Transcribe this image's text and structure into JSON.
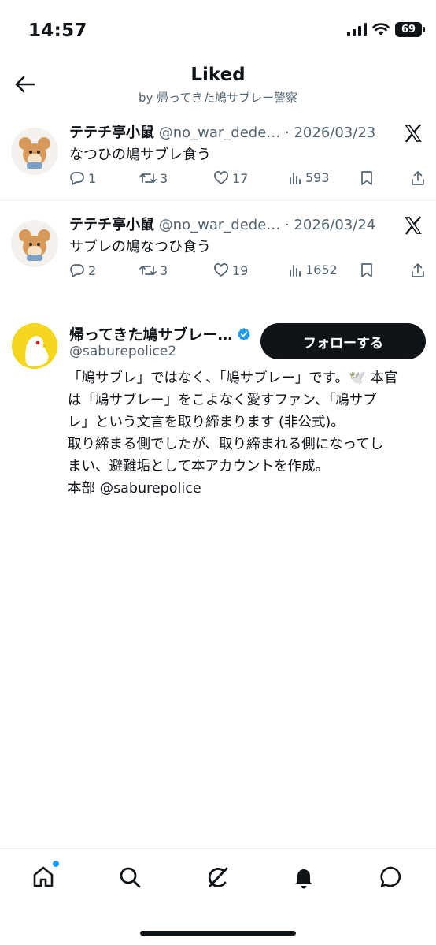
{
  "status_bar": {
    "time": "14:57",
    "battery": "69"
  },
  "header": {
    "title": "Liked",
    "subtitle": "by 帰ってきた鳩サブレー警察"
  },
  "tweets": [
    {
      "name": "テテチ亭小鼠",
      "handle": "@no_war_dede…",
      "separator": " · ",
      "date": "2026/03/23",
      "text": "なつひの鳩サブレ食う",
      "replies": "1",
      "retweets": "3",
      "likes": "17",
      "views": "593"
    },
    {
      "name": "テテチ亭小鼠",
      "handle": "@no_war_dede…",
      "separator": " · ",
      "date": "2026/03/24",
      "text": "サブレの鳩なつひ食う",
      "replies": "2",
      "retweets": "3",
      "likes": "19",
      "views": "1652"
    }
  ],
  "user": {
    "name": "帰ってきた鳩サブレー…",
    "handle": "@saburepolice2",
    "follow_label": "フォローする",
    "bio_lines": [
      "「鳩サブレ」ではなく、「鳩サブレー」です。🕊️ 本官",
      "は「鳩サブレー」をこよなく愛すファン、「鳩サブ",
      "レ」という文言を取り締まります (非公式)。",
      "取り締まる側でしたが、取り締まれる側になってし",
      "まい、避難垢として本アカウントを作成。",
      "本部 @saburepolice"
    ]
  },
  "icons": {
    "back": "arrow-left-icon",
    "x_logo": "x-logo-icon",
    "nav": [
      "home-icon",
      "search-icon",
      "grok-icon",
      "notifications-icon",
      "messages-icon"
    ]
  },
  "colors": {
    "text": "#0f1419",
    "secondary": "#536471",
    "accent": "#1d9bf0"
  }
}
